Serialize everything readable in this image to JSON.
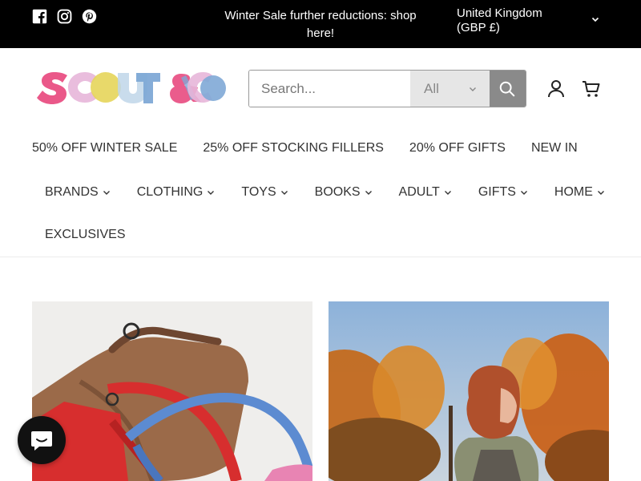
{
  "announcement": {
    "text": "Winter Sale further reductions: shop here!",
    "currency_line1": "United Kingdom",
    "currency_line2": "(GBP £)"
  },
  "social": [
    "facebook-icon",
    "instagram-icon",
    "pinterest-icon"
  ],
  "brand": {
    "logo_alt": "SCOUT & CO"
  },
  "search": {
    "placeholder": "Search...",
    "category": "All"
  },
  "promo_nav": [
    "50% OFF WINTER SALE",
    "25% OFF STOCKING FILLERS",
    "20% OFF GIFTS",
    "NEW IN"
  ],
  "main_nav": [
    "BRANDS",
    "CLOTHING",
    "TOYS",
    "BOOKS",
    "ADULT",
    "GIFTS",
    "HOME"
  ],
  "main_nav_extra": "EXCLUSIVES",
  "colors": {
    "topbar": "#000000",
    "logo_pink": "#e84a7f",
    "logo_yellow": "#e6d55a",
    "logo_blue": "#7fa9d6",
    "logo_lilac": "#e7b6d9"
  }
}
